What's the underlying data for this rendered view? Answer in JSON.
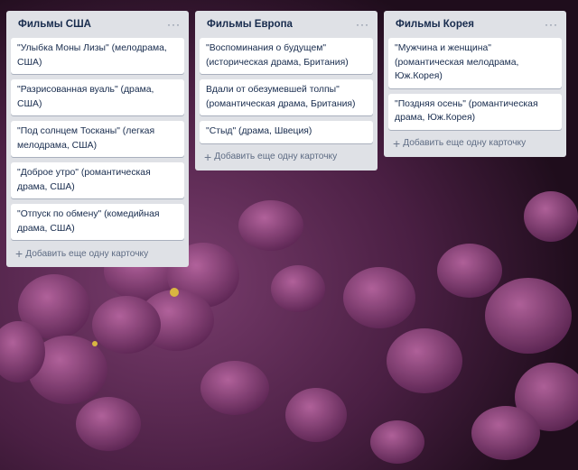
{
  "colors": {
    "list_bg": "#dfe1e6",
    "card_bg": "#ffffff",
    "title_text": "#172b4d",
    "muted_text": "#5e6c84",
    "background": "#3a1832"
  },
  "lists": [
    {
      "title": "Фильмы США",
      "menu": "···",
      "cards": [
        "\"Улыбка Моны Лизы\" (мелодрама, США)",
        "\"Разрисованная вуаль\" (драма, США)",
        "\"Под солнцем Тосканы\" (легкая мелодрама, США)",
        "\"Доброе утро\" (романтическая драма, США)",
        "\"Отпуск по обмену\" (комедийная драма, США)"
      ],
      "add_label": "Добавить еще одну карточку"
    },
    {
      "title": "Фильмы Европа",
      "menu": "···",
      "cards": [
        "\"Воспоминания о будущем\" (историческая драма, Британия)",
        "Вдали от обезумевшей толпы\" (романтическая драма, Британия)",
        "\"Стыд\" (драма, Швеция)"
      ],
      "add_label": "Добавить еще одну карточку"
    },
    {
      "title": "Фильмы Корея",
      "menu": "···",
      "cards": [
        "\"Мужчина и женщина\" (романтическая мелодрама, Юж.Корея)",
        "\"Поздняя осень\" (романтическая драма, Юж.Корея)"
      ],
      "add_label": "Добавить еще одну карточку"
    }
  ]
}
